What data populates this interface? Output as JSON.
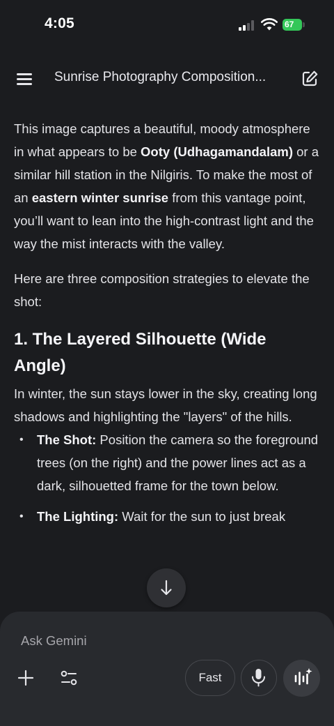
{
  "status_bar": {
    "time": "4:05",
    "battery_level": "67",
    "battery_color": "#34c759"
  },
  "header": {
    "title": "Sunrise Photography Composition...",
    "menu_icon": "hamburger-menu-icon",
    "new_chat_icon": "edit-square-icon"
  },
  "content": {
    "para1": {
      "t1": "This image captures a beautiful, moody atmosphere in what appears to be ",
      "b1": "Ooty (Udhagamandalam)",
      "t2": " or a similar hill station in the Nilgiris. To make the most of an ",
      "b2": "eastern winter sunrise",
      "t3": " from this vantage point, you’ll want to lean into the high-contrast light and the way the mist interacts with the valley."
    },
    "para2": "Here are three composition strategies to elevate the shot:",
    "section1": {
      "heading": "1. The Layered Silhouette (Wide Angle)",
      "intro": "In winter, the sun stays lower in the sky, creating long shadows and highlighting the \"layers\" of the hills.",
      "bullets": [
        {
          "label": "The Shot:",
          "text": " Position the camera so the foreground trees (on the right) and the power lines act as a dark, silhouetted frame for the town below."
        },
        {
          "label": "The Lighting:",
          "text": " Wait for the sun to just break"
        }
      ]
    }
  },
  "scroll_button": {
    "icon": "arrow-down-icon"
  },
  "input_panel": {
    "placeholder": "Ask Gemini",
    "plus_icon": "plus-icon",
    "tools_icon": "tools-sliders-icon",
    "fast_label": "Fast",
    "mic_icon": "microphone-icon",
    "live_icon": "gemini-live-icon"
  },
  "colors": {
    "background": "#1b1c1f",
    "panel": "#282a2e",
    "text": "#e3e3e7"
  }
}
